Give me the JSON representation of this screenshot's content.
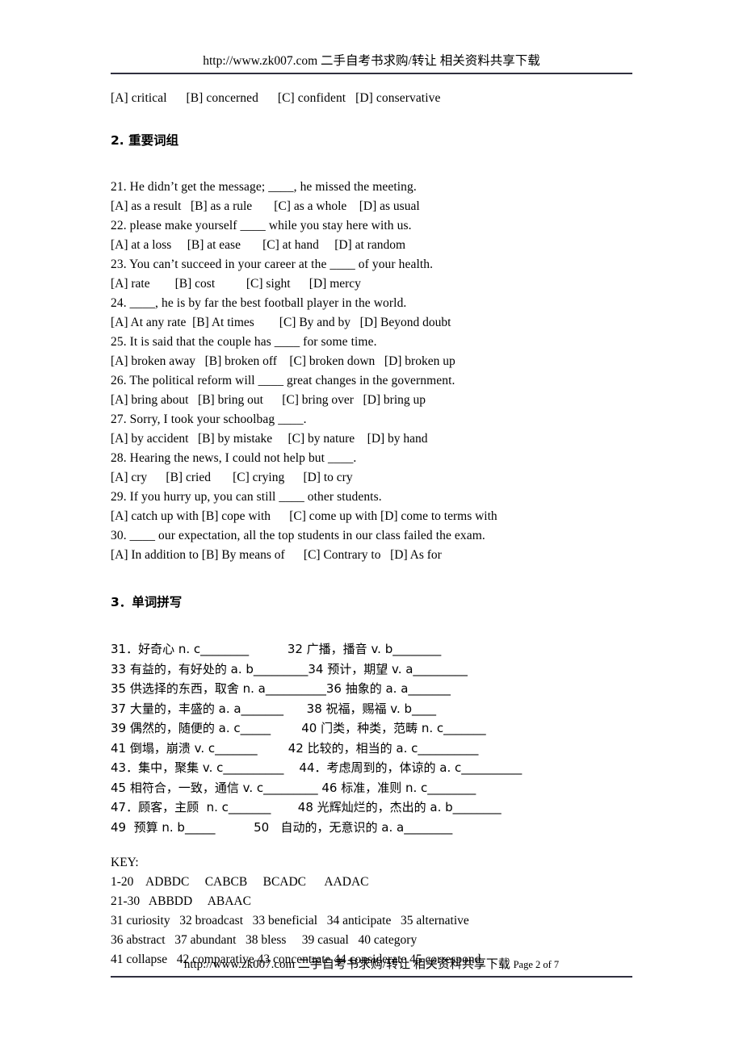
{
  "header": {
    "text": "http://www.zk007.com  二手自考书求购/转让  相关资料共享下载"
  },
  "footer": {
    "text": "http://www.zk007.com 二手自考书求购/转让 相关资料共享下载",
    "page_label": "Page 2 of 7"
  },
  "carryover_options": "[A] critical      [B] concerned      [C] confident   [D] conservative",
  "sections": [
    {
      "heading": "2. 重要词组",
      "questions": [
        {
          "stem": "21. He didn’t get the message; ____, he missed the meeting.",
          "options": "[A] as a result   [B] as a rule       [C] as a whole    [D] as usual"
        },
        {
          "stem": "22. please make yourself ____ while you stay here with us.",
          "options": "[A] at a loss     [B] at ease       [C] at hand     [D] at random"
        },
        {
          "stem": "23. You can’t succeed in your career at the ____ of your health.",
          "options": "[A] rate        [B] cost          [C] sight      [D] mercy"
        },
        {
          "stem": "24. ____, he is by far the best football player in the world.",
          "options": "[A] At any rate  [B] At times        [C] By and by   [D] Beyond doubt"
        },
        {
          "stem": "25. It is said that the couple has ____ for some time.",
          "options": "[A] broken away   [B] broken off    [C] broken down   [D] broken up"
        },
        {
          "stem": "26. The political reform will ____ great changes in the government.",
          "options": "[A] bring about   [B] bring out      [C] bring over   [D] bring up"
        },
        {
          "stem": "27. Sorry, I took your schoolbag ____.",
          "options": "[A] by accident   [B] by mistake     [C] by nature    [D] by hand"
        },
        {
          "stem": "28. Hearing the news, I could not help but ____.",
          "options": "[A] cry      [B] cried       [C] crying      [D] to cry"
        },
        {
          "stem": "29. If you hurry up, you can still ____ other students.",
          "options": "[A] catch up with [B] cope with      [C] come up with [D] come to terms with"
        },
        {
          "stem": "30. ____ our expectation, all the top students in our class failed the exam.",
          "options": "[A] In addition to [B] By means of      [C] Contrary to   [D] As for"
        }
      ]
    }
  ],
  "spelling_section": {
    "heading": "3．单词拼写",
    "lines": [
      "31．好奇心 n. c________          32 广播，播音 v. b________",
      "33 有益的，有好处的 a. b_________34 预计，期望 v. a_________",
      "35 供选择的东西，取舍 n. a__________36 抽象的 a. a_______",
      "37 大量的，丰盛的 a. a_______      38 祝福，赐福 v. b____",
      "39 偶然的，随便的 a. c_____        40 门类，种类，范畴 n. c_______",
      "41 倒塌，崩溃 v. c_______        42 比较的，相当的 a. c__________",
      "43．集中，聚集 v. c__________    44．考虑周到的，体谅的 a. c__________",
      "45 相符合，一致，通信 v. c_________ 46 标准，准则 n. c________",
      "47．顾客，主顾  n. c_______       48 光辉灿烂的，杰出的 a. b________",
      "49  预算 n. b_____          50   自动的，无意识的 a. a________"
    ]
  },
  "key": {
    "title": "KEY:",
    "lines": [
      "1-20    ADBDC     CABCB     BCADC      AADAC",
      "21-30   ABBDD     ABAAC",
      "31 curiosity   32 broadcast   33 beneficial   34 anticipate   35 alternative",
      "36 abstract   37 abundant   38 bless     39 casual   40 category",
      "41 collapse   42 comparative 43 concentrate 44 considerate 45 correspond"
    ]
  }
}
